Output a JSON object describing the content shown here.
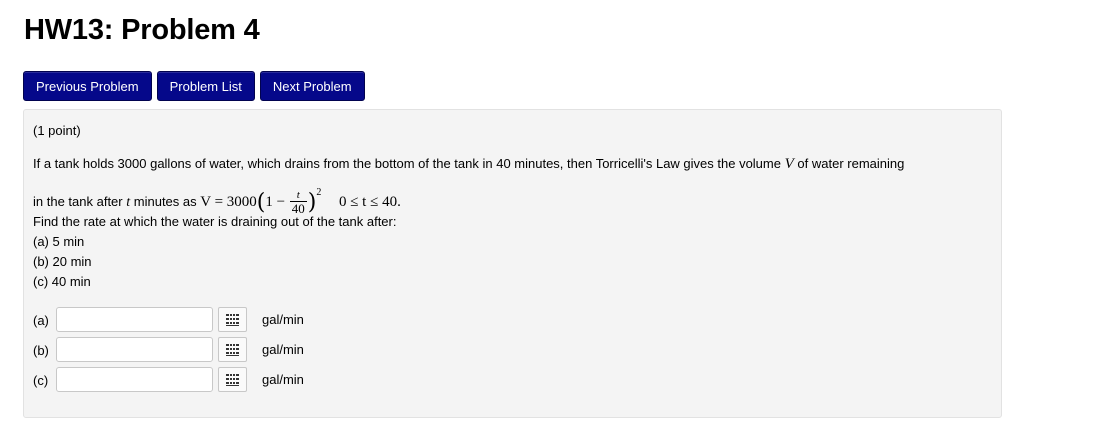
{
  "page_title": "HW13: Problem 4",
  "nav": {
    "previous_label": "Previous Problem",
    "list_label": "Problem List",
    "next_label": "Next Problem"
  },
  "problem": {
    "points": "(1 point)",
    "intro_line1": "If a tank holds 3000 gallons of water, which drains from the bottom of the tank in 40 minutes, then Torricelli's Law gives the volume",
    "var_V": "V",
    "intro_line1_end": "of water remaining",
    "line2_start": "in the tank after",
    "var_t": "t",
    "line2_mid": "minutes as",
    "formula_lhs": "V = 3000",
    "formula_minus": "1 −",
    "frac_num": "t",
    "frac_den": "40",
    "exponent": "2",
    "domain": "0 ≤ t ≤ 40.",
    "question": "Find the rate at which the water is draining out of the tank after:",
    "parts": [
      "(a) 5 min",
      "(b) 20 min",
      "(c) 40 min"
    ]
  },
  "answers": [
    {
      "label": "(a)",
      "value": "",
      "unit": "gal/min"
    },
    {
      "label": "(b)",
      "value": "",
      "unit": "gal/min"
    },
    {
      "label": "(c)",
      "value": "",
      "unit": "gal/min"
    }
  ],
  "icons": {
    "palette": "grid-palette-icon"
  },
  "colors": {
    "button_bg": "#05088a",
    "panel_bg": "#f4f4f4"
  }
}
